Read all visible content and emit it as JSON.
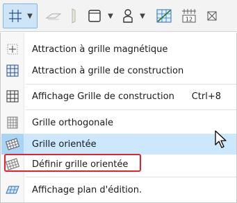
{
  "toolbar": {
    "buttons": [
      {
        "name": "construction-grid-icon",
        "selected": true
      },
      {
        "name": "layer-icon"
      },
      {
        "name": "pencil-icon"
      },
      {
        "name": "window-icon"
      },
      {
        "name": "user-icon"
      },
      {
        "name": "grid-plan-icon"
      },
      {
        "name": "numbered-grid-icon"
      },
      {
        "name": "cross-icon"
      }
    ],
    "numbered_grid_text": "12"
  },
  "menu": {
    "items": [
      {
        "label": "Attraction à grille magnétique",
        "icon": "magnetic-grid-icon"
      },
      {
        "label": "Attraction à grille de construction",
        "icon": "construction-grid-snap-icon"
      },
      {
        "label": "Affichage Grille de construction",
        "icon": "grid-display-icon",
        "shortcut": "Ctrl+8"
      },
      {
        "label": "Grille orthogonale",
        "icon": "orthogonal-grid-icon"
      },
      {
        "label": "Grille orientée",
        "icon": "oriented-grid-icon",
        "highlighted": true
      },
      {
        "label": "Définir grille orientée",
        "icon": "define-oriented-grid-icon",
        "boxed": true
      },
      {
        "label": "Affichage plan d'édition.",
        "icon": "edit-plane-icon"
      }
    ]
  },
  "colors": {
    "highlight": "#cce8ff",
    "annotation_box": "#e8202a",
    "toolbar_selected": "#cde5f7"
  }
}
